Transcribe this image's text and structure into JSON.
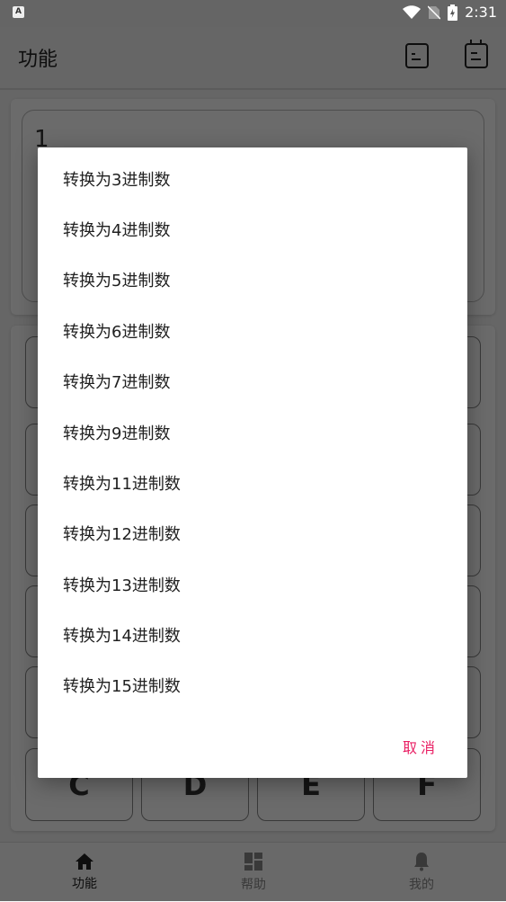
{
  "status_bar": {
    "time": "2:31",
    "left_icon": "A",
    "icons": [
      "wifi-icon",
      "no-sim-icon",
      "battery-charging-icon"
    ]
  },
  "app_bar": {
    "title": "功能",
    "icons": [
      "history-icon",
      "clipboard-icon"
    ]
  },
  "display": {
    "value": "1"
  },
  "keypad": {
    "last_row": [
      "C",
      "D",
      "E",
      "F"
    ]
  },
  "dialog": {
    "items": [
      "转换为3进制数",
      "转换为4进制数",
      "转换为5进制数",
      "转换为6进制数",
      "转换为7进制数",
      "转换为9进制数",
      "转换为11进制数",
      "转换为12进制数",
      "转换为13进制数",
      "转换为14进制数",
      "转换为15进制数"
    ],
    "cancel_label": "取消",
    "cancel_color": "#e91e63"
  },
  "bottom_nav": {
    "items": [
      {
        "label": "功能",
        "icon": "home-icon",
        "active": true
      },
      {
        "label": "帮助",
        "icon": "dashboard-icon",
        "active": false
      },
      {
        "label": "我的",
        "icon": "bell-icon",
        "active": false
      }
    ]
  }
}
